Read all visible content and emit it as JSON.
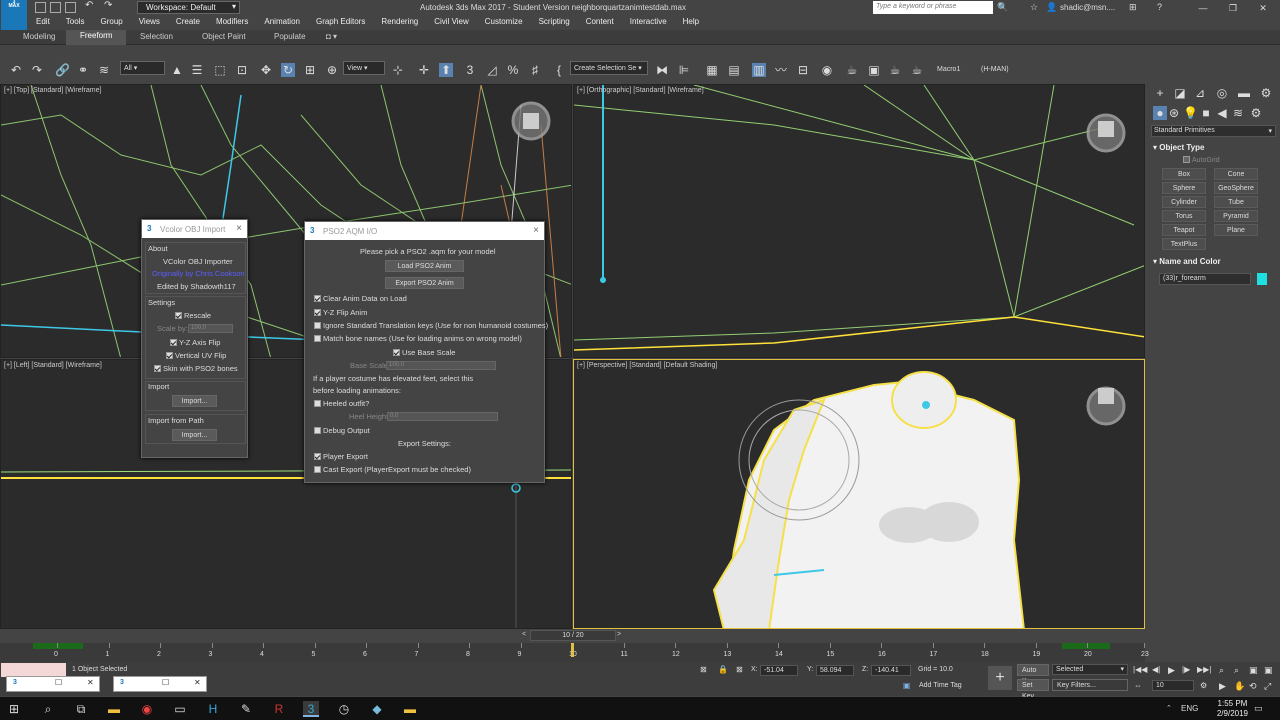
{
  "window": {
    "title": "Autodesk 3ds Max 2017 - Student Version   neighborquartzanimtestdab.max",
    "workspace": "Workspace: Default",
    "search_placeholder": "Type a keyword or phrase",
    "user": "shadic@msn....",
    "app_logo": "3",
    "app_logo_sub": "MAX"
  },
  "menu": [
    "Edit",
    "Tools",
    "Group",
    "Views",
    "Create",
    "Modifiers",
    "Animation",
    "Graph Editors",
    "Rendering",
    "Civil View",
    "Customize",
    "Scripting",
    "Content",
    "Interactive",
    "Help"
  ],
  "ribbon_tabs": [
    "Modeling",
    "Freeform",
    "Selection",
    "Object Paint",
    "Populate"
  ],
  "toolbar": {
    "filter": "All",
    "view_dropdown": "View",
    "selection_set": "Create Selection Se",
    "macro": "Macro1",
    "hman": "(H-MAN)"
  },
  "viewports": {
    "top": "[+] [Top] [Standard] [Wireframe]",
    "ortho": "[+] [Orthographic] [Standard] [Wireframe]",
    "left": "[+] [Left] [Standard] [Wireframe]",
    "persp": "[+] [Perspective] [Standard] [Default Shading]"
  },
  "command_panel": {
    "dropdown": "Standard Primitives",
    "object_type_title": "Object Type",
    "autogrid": "AutoGrid",
    "buttons": [
      "Box",
      "Cone",
      "Sphere",
      "GeoSphere",
      "Cylinder",
      "Tube",
      "Torus",
      "Pyramid",
      "Teapot",
      "Plane",
      "TextPlus"
    ],
    "name_color_title": "Name and Color",
    "object_name": "(33)r_forearm",
    "object_color": "#1ee0e0"
  },
  "vcolor_dialog": {
    "title": "Vcolor OBJ Import",
    "about": "About",
    "name": "VColor OBJ Importer",
    "credit": "Originally by Chris Cookson",
    "edited": "Edited by Shadowth117",
    "settings": "Settings",
    "rescale": "Rescale",
    "scale_by_label": "Scale by:",
    "scale_by_value": "100.0",
    "yz_flip": "Y-Z Axis Flip",
    "vertical_uv": "Vertical UV Flip",
    "skin_pso2": "Skin with PSO2 bones",
    "import": "Import",
    "import_btn": "Import...",
    "import_path": "Import from Path",
    "import_path_btn": "Import..."
  },
  "pso2_dialog": {
    "title": "PSO2 AQM I/O",
    "prompt": "Please pick a PSO2 .aqm for your model",
    "load_btn": "Load PSO2 Anim",
    "export_btn": "Export PSO2 Anim",
    "clear_anim": "Clear Anim Data on Load",
    "yz_flip": "Y-Z Flip Anim",
    "ignore_std": "Ignore Standard Translation keys (Use for non humanoid costumes)",
    "match_bone": "Match bone names (Use for loading anims on wrong model)",
    "use_base_scale": "Use Base Scale",
    "base_scale_label": "Base Scale",
    "base_scale_value": "100.0",
    "feet_note_1": "If a player costume has elevated feet, select this",
    "feet_note_2": "before loading animations:",
    "heeled": "Heeled outfit?",
    "heel_height_label": "Heel Height",
    "heel_height_value": "0.0",
    "debug": "Debug Output",
    "export_settings": "Export Settings:",
    "player_export": "Player Export",
    "cast_export": "Cast Export (PlayerExport must be checked)"
  },
  "timeline": {
    "frame": "10 / 20",
    "ticks": [
      "0",
      "1",
      "2",
      "3",
      "4",
      "5",
      "6",
      "7",
      "8",
      "9",
      "10",
      "11",
      "12",
      "13",
      "14",
      "15",
      "16",
      "17",
      "18",
      "19",
      "20",
      "23"
    ],
    "current_frame_fraction": 0.5
  },
  "status": {
    "selected": "1 Object Selected",
    "x_label": "X:",
    "x": "-51.04",
    "y_label": "Y:",
    "y": "58.094",
    "z_label": "Z:",
    "z": "-140.41",
    "grid": "Grid = 10.0",
    "add_time_tag": "Add Time Tag",
    "auto_key": "Auto Key",
    "selected_dropdown": "Selected",
    "set_key": "Set Key",
    "key_filters": "Key Filters...",
    "frame_field": "10"
  },
  "taskbar": {
    "lang": "ENG",
    "time": "1:55 PM",
    "date": "2/9/2019"
  }
}
